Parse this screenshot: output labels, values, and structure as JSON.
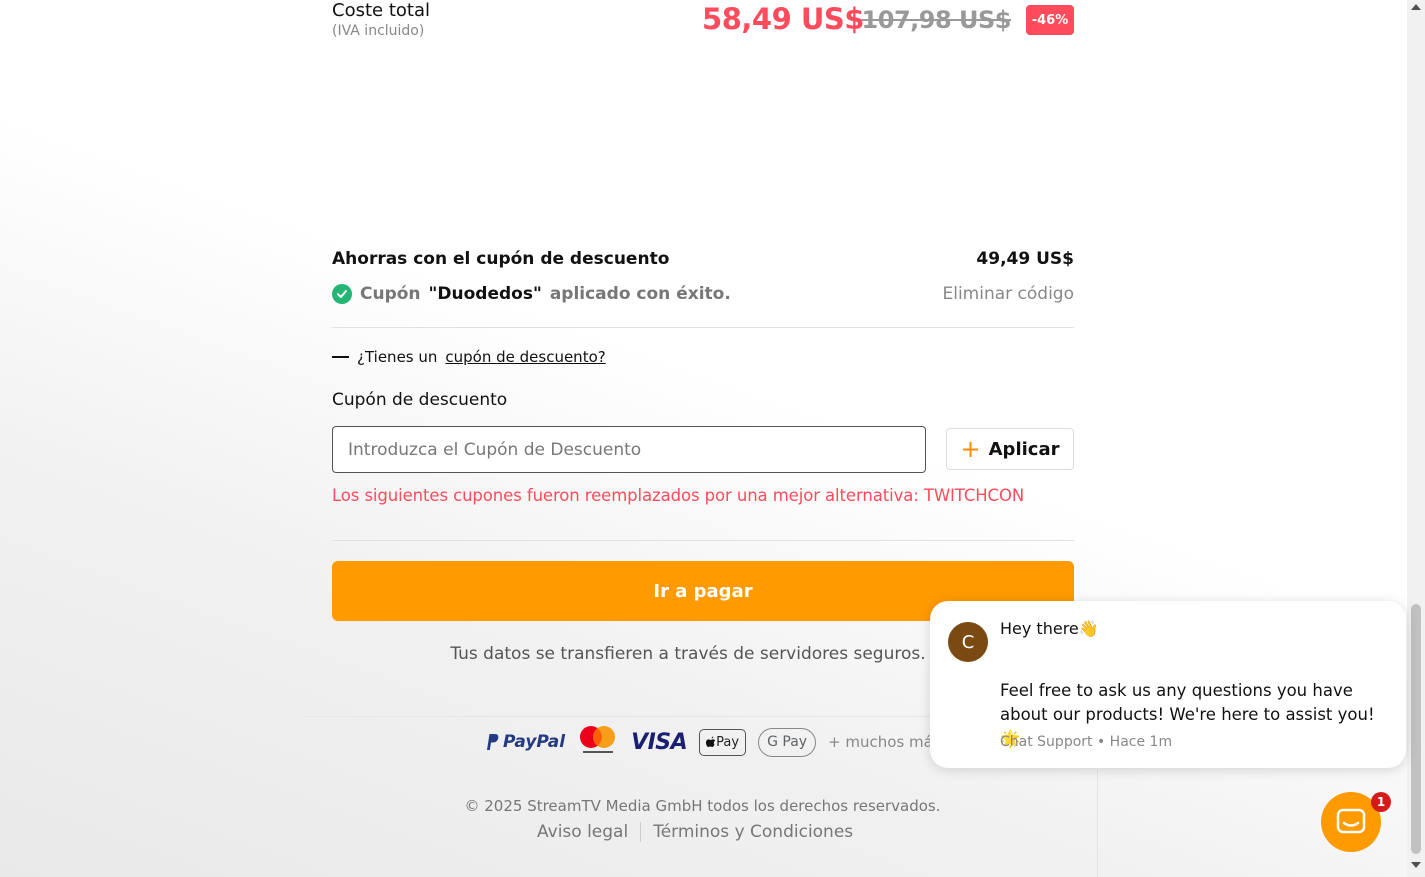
{
  "summary": {
    "total_label": "Coste total",
    "total_sub": "(IVA incluido)",
    "price": "58,49 US$",
    "old_price": "107,98 US$",
    "discount_badge": "-46%"
  },
  "coupon_savings": {
    "label": "Ahorras con el cupón de descuento",
    "value": "49,49 US$",
    "prefix": "Cupón",
    "code": "\"Duodedos\"",
    "suffix": "aplicado con éxito.",
    "remove_label": "Eliminar código"
  },
  "coupon_toggle": {
    "prefix": "¿Tienes un",
    "link": "cupón de descuento?"
  },
  "coupon_form": {
    "label": "Cupón de descuento",
    "value": "",
    "placeholder": "Introduzca el Cupón de Descuento",
    "apply_label": "Aplicar",
    "warning": "Los siguientes cupones fueron reemplazados por una mejor alternativa: TWITCHCON"
  },
  "checkout": {
    "pay_label": "Ir a pagar",
    "secure_text": "Tus datos se transfieren a través de servidores seguros."
  },
  "payment_methods": {
    "paypal_a": "PayPal",
    "applepay": "Pay",
    "gpay": "G Pay",
    "more": "+ muchos más"
  },
  "footer": {
    "copyright": "© 2025 StreamTV Media GmbH todos los derechos reservados.",
    "legal": "Aviso legal",
    "terms": "Términos y Condiciones"
  },
  "chat": {
    "avatar_initial": "C",
    "greeting": "Hey there👋",
    "message": "Feel free to ask us any questions you have about our products! We're here to assist you! 🌟",
    "meta": "Chat Support • Hace 1m",
    "unread_count": "1"
  },
  "colors": {
    "accent": "#ff9a00",
    "price_red": "#ff4b5c",
    "success_green": "#22b573"
  }
}
